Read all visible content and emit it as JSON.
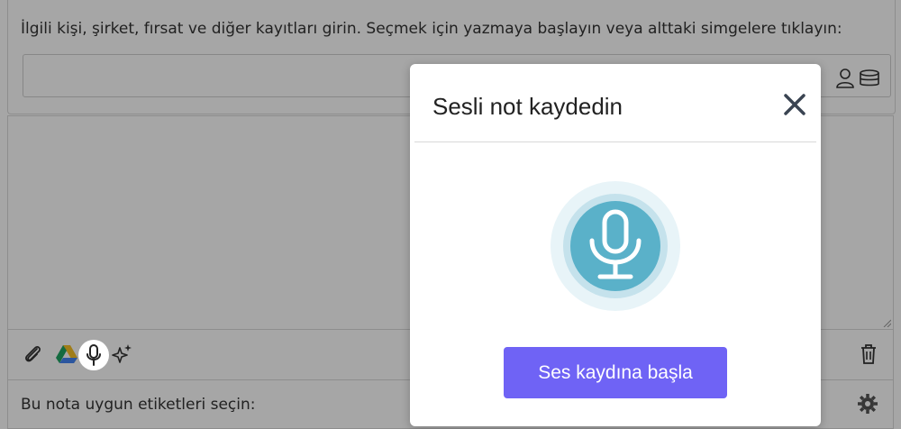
{
  "related": {
    "label": "İlgili kişi, şirket, fırsat ve diğer kayıtları girin. Seçmek için yazmaya başlayın veya alttaki simgelere tıklayın:",
    "input_value": "",
    "icons": [
      "person-icon",
      "database-icon"
    ]
  },
  "toolbar": {
    "icons": [
      "paperclip-icon",
      "google-drive-icon",
      "microphone-icon",
      "sparkle-icon",
      "trash-icon"
    ]
  },
  "tags": {
    "label": "Bu nota uygun etiketleri seçin:",
    "icon": "gear-icon"
  },
  "modal": {
    "title": "Sesli not kaydedin",
    "close_icon": "close-icon",
    "mic_icon": "microphone-icon",
    "record_button": "Ses kaydına başla"
  },
  "colors": {
    "accent": "#6f63f5",
    "mic_fill": "#5ab1c9",
    "mic_ring_outer": "#e8f4f8",
    "mic_ring_inner": "#c5e2ec"
  }
}
